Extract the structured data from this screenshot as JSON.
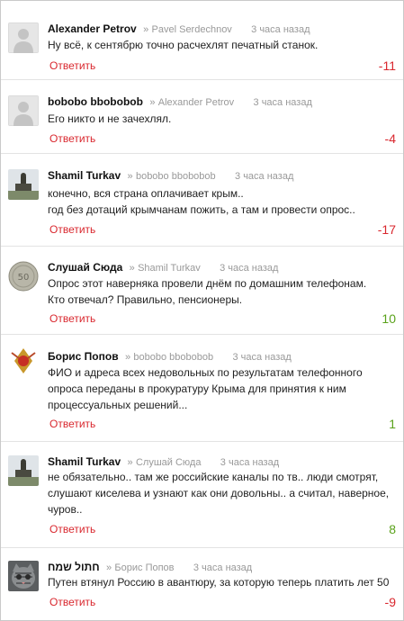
{
  "reply_label": "Ответить",
  "reply_separator": "»",
  "colors": {
    "reply": "#d9272e",
    "negative": "#d9272e",
    "positive": "#5aa21b",
    "meta": "#999999"
  },
  "comments": [
    {
      "author": "Alexander Petrov",
      "reply_to": "Pavel Serdechnov",
      "time": "3 часа назад",
      "text": "Ну всё, к сентябрю точно расчехлят печатный станок.",
      "score": "-11",
      "avatar": "default-user-avatar"
    },
    {
      "author": "bobobo bbobobob",
      "reply_to": "Alexander Petrov",
      "time": "3 часа назад",
      "text": "Его никто и не зачехлял.",
      "score": "-4",
      "avatar": "default-user-avatar"
    },
    {
      "author": "Shamil Turkav",
      "reply_to": "bobobo bbobobob",
      "time": "3 часа назад",
      "text": "конечно, вся страна оплачивает крым..\nгод без дотаций крымчанам пожить, а там и провести опрос..",
      "score": "-17",
      "avatar": "monument-photo-avatar"
    },
    {
      "author": "Слушай Сюда",
      "reply_to": "Shamil Turkav",
      "time": "3 часа назад",
      "text": "Опрос этот наверняка провели днём по домашним телефонам.\nКто отвечал? Правильно, пенсионеры.",
      "score": "10",
      "avatar": "coin-avatar"
    },
    {
      "author": "Борис Попов",
      "reply_to": "bobobo bbobobob",
      "time": "3 часа назад",
      "text": "ФИО и адреса всех недовольных по результатам телефонного\nопроса переданы в прокуратуру Крыма для принятия к ним\nпроцессуальных решений...",
      "score": "1",
      "avatar": "badge-avatar"
    },
    {
      "author": "Shamil Turkav",
      "reply_to": "Слушай Сюда",
      "time": "3 часа назад",
      "text": "не обязательно.. там же российские каналы по тв.. люди смотрят,\nслушают киселева и узнают как они довольны.. а считал, наверное,\nчуров..",
      "score": "8",
      "avatar": "monument-photo-avatar"
    },
    {
      "author": "חתול שמח",
      "reply_to": "Борис Попов",
      "time": "3 часа назад",
      "text": "Путен втянул Россию в авантюру, за которую теперь платить лет 50",
      "score": "-9",
      "avatar": "cat-photo-avatar"
    }
  ]
}
